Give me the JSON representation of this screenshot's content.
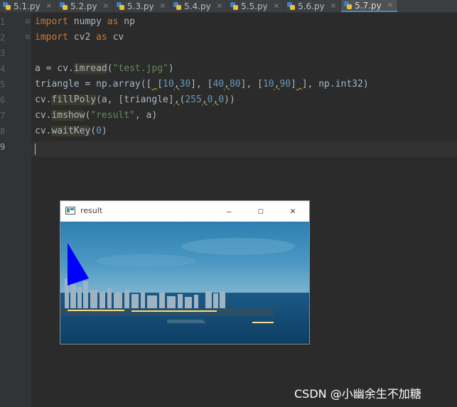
{
  "tabs": [
    {
      "label": "5.1.py",
      "active": false
    },
    {
      "label": "5.2.py",
      "active": false
    },
    {
      "label": "5.3.py",
      "active": false
    },
    {
      "label": "5.4.py",
      "active": false
    },
    {
      "label": "5.5.py",
      "active": false
    },
    {
      "label": "5.6.py",
      "active": false
    },
    {
      "label": "5.7.py",
      "active": true
    }
  ],
  "tab_close_glyph": "×",
  "line_numbers": [
    "1",
    "2",
    "3",
    "4",
    "5",
    "6",
    "7",
    "8",
    "9"
  ],
  "code": {
    "l1": {
      "kw1": "import",
      "mod": " numpy ",
      "kw2": "as",
      "alias": " np"
    },
    "l2": {
      "kw1": "import",
      "mod": " cv2 ",
      "kw2": "as",
      "alias": " cv"
    },
    "l4": {
      "pre": "a = cv.",
      "fn": "imread",
      "open": "(",
      "str": "\"test.jpg\"",
      "close": ")"
    },
    "l5": {
      "pre": "triangle = np.array([",
      "sp1": " ",
      "b1": "[",
      "n1": "10",
      "c1": ",",
      "n2": "30",
      "b2": "]",
      "sep1": ", ",
      "b3": "[",
      "n3": "40",
      "c2": ",",
      "n4": "80",
      "b4": "]",
      "sep2": ", ",
      "b5": "[",
      "n5": "10",
      "c3": ",",
      "n6": "90",
      "b6": "]",
      "sp2": " ",
      "post": "], np.int32)"
    },
    "l6": {
      "pre": "cv.",
      "fn": "fillPoly",
      "mid": "(a, [triangle]",
      "sq": ",",
      "open": "(",
      "n1": "255",
      "c1": ",",
      "n2": "0",
      "c2": ",",
      "n3": "0",
      "close": "))"
    },
    "l7": {
      "pre": "cv.",
      "fn": "imshow",
      "open": "(",
      "str": "\"result\"",
      "post": ", a)"
    },
    "l8": {
      "pre": "cv.",
      "fn": "waitKey",
      "open": "(",
      "num": "0",
      "close": ")"
    }
  },
  "cv_window": {
    "title": "result",
    "minimize": "—",
    "maximize": "☐",
    "close": "✕",
    "triangle_color": "#0000ff"
  },
  "watermark": "CSDN @小幽余生不加糖",
  "colors": {
    "editor_bg": "#2b2b2b",
    "keyword": "#cc7832",
    "string": "#6a8759",
    "number": "#6897bb",
    "text": "#a9b7c6"
  }
}
